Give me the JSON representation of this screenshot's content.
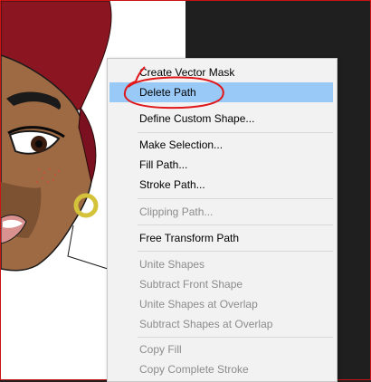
{
  "context_menu": {
    "items": [
      {
        "label": "Create Vector Mask",
        "enabled": true
      },
      {
        "label": "Delete Path",
        "enabled": true,
        "highlighted": true
      },
      {
        "label": "Define Custom Shape...",
        "enabled": true
      },
      {
        "label": "Make Selection...",
        "enabled": true
      },
      {
        "label": "Fill Path...",
        "enabled": true
      },
      {
        "label": "Stroke Path...",
        "enabled": true
      },
      {
        "label": "Clipping Path...",
        "enabled": false
      },
      {
        "label": "Free Transform Path",
        "enabled": true
      },
      {
        "label": "Unite Shapes",
        "enabled": false
      },
      {
        "label": "Subtract Front Shape",
        "enabled": false
      },
      {
        "label": "Unite Shapes at Overlap",
        "enabled": false
      },
      {
        "label": "Subtract Shapes at Overlap",
        "enabled": false
      },
      {
        "label": "Copy Fill",
        "enabled": false
      },
      {
        "label": "Copy Complete Stroke",
        "enabled": false
      }
    ]
  },
  "colors": {
    "highlight": "#99c9f6",
    "annotation": "#e0181b",
    "menu_background": "#f2f2f2",
    "canvas_dark": "#1f1f1f"
  }
}
